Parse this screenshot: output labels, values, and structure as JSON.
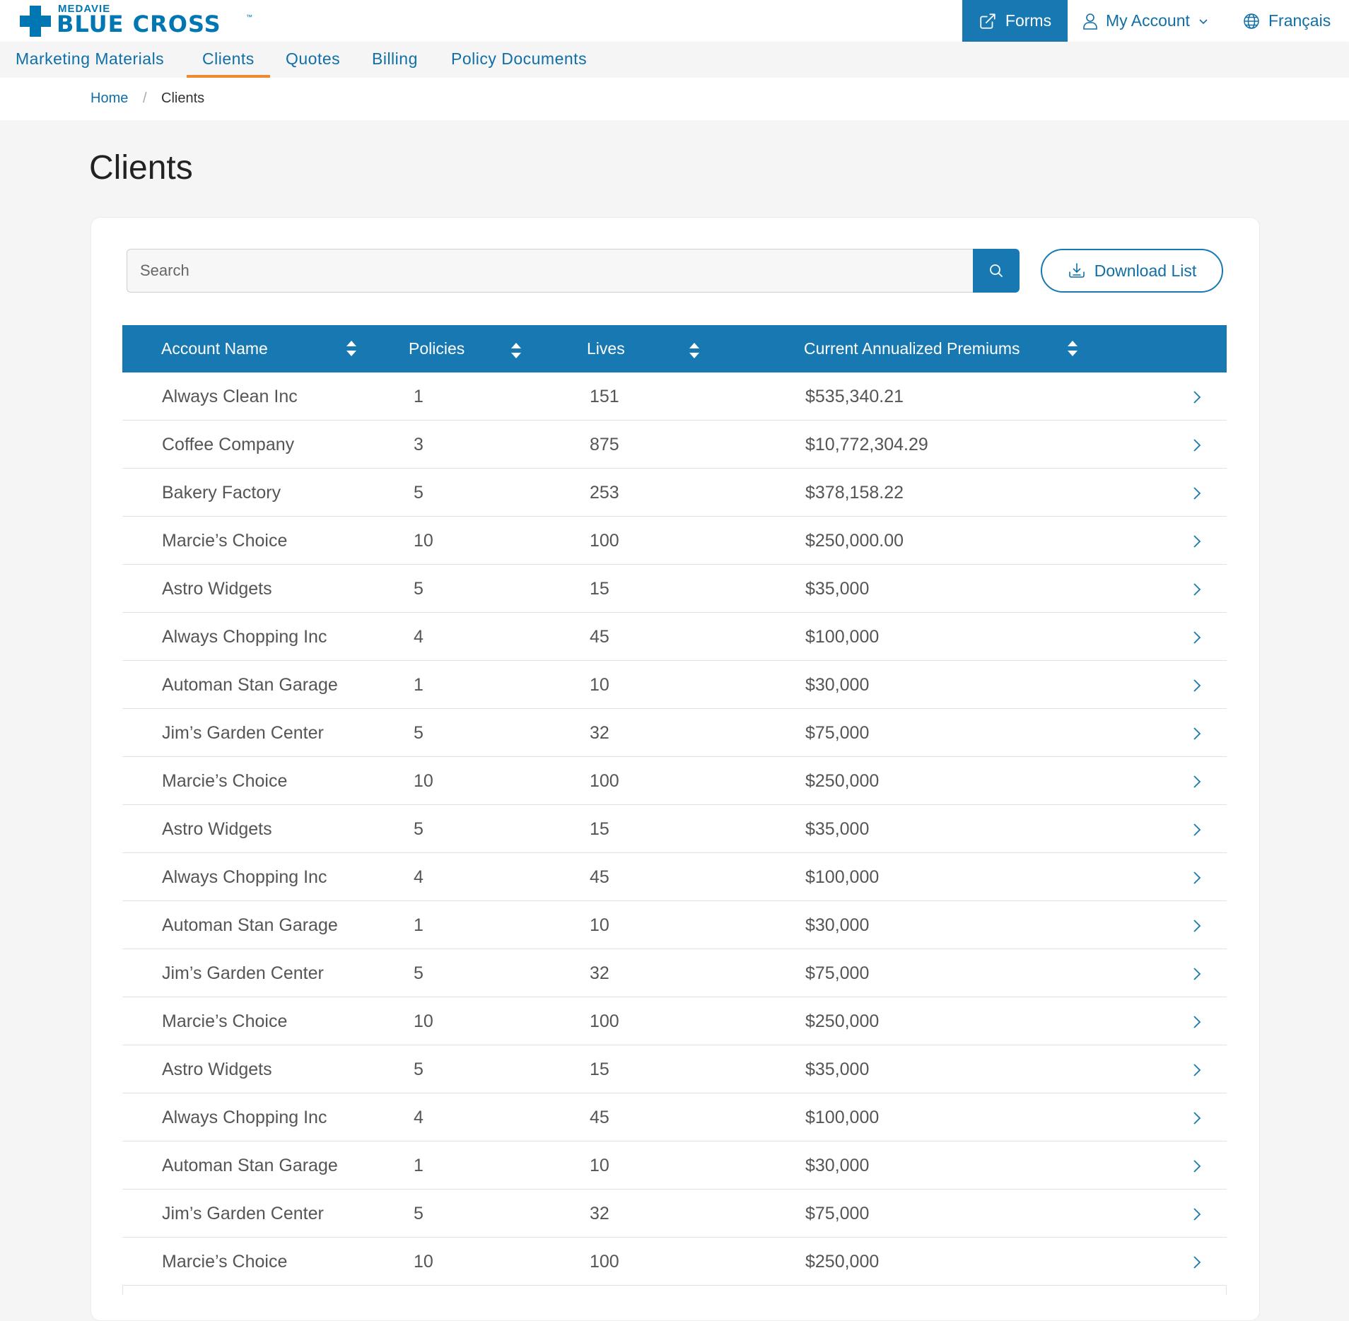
{
  "brand": {
    "top_text": "MEDAVIE",
    "main_text": "BLUE CROSS",
    "trademark": "™",
    "color": "#0077b3"
  },
  "header": {
    "forms_label": "Forms",
    "account_label": "My Account",
    "language_label": "Français",
    "accent_color": "#1878b2"
  },
  "nav": {
    "items": [
      {
        "label": "Marketing Materials",
        "active": false
      },
      {
        "label": "Clients",
        "active": true
      },
      {
        "label": "Quotes",
        "active": false
      },
      {
        "label": "Billing",
        "active": false
      },
      {
        "label": "Policy Documents",
        "active": false
      }
    ],
    "active_underline_color": "#ee8a2d"
  },
  "breadcrumb": {
    "home": "Home",
    "separator": "/",
    "current": "Clients"
  },
  "page": {
    "title": "Clients"
  },
  "search": {
    "placeholder": "Search",
    "value": ""
  },
  "download": {
    "label": "Download List"
  },
  "table": {
    "columns": [
      {
        "label": "Account Name"
      },
      {
        "label": "Policies"
      },
      {
        "label": "Lives"
      },
      {
        "label": "Current Annualized Premiums"
      }
    ],
    "rows": [
      {
        "name": "Always Clean Inc",
        "policies": "1",
        "lives": "151",
        "premium": "$535,340.21"
      },
      {
        "name": "Coffee Company",
        "policies": "3",
        "lives": "875",
        "premium": "$10,772,304.29"
      },
      {
        "name": "Bakery Factory",
        "policies": "5",
        "lives": "253",
        "premium": "$378,158.22"
      },
      {
        "name": "Marcie’s Choice",
        "policies": "10",
        "lives": "100",
        "premium": "$250,000.00"
      },
      {
        "name": "Astro Widgets",
        "policies": "5",
        "lives": "15",
        "premium": "$35,000"
      },
      {
        "name": "Always Chopping Inc",
        "policies": "4",
        "lives": "45",
        "premium": "$100,000"
      },
      {
        "name": "Automan Stan Garage",
        "policies": "1",
        "lives": "10",
        "premium": "$30,000"
      },
      {
        "name": "Jim’s Garden Center",
        "policies": "5",
        "lives": "32",
        "premium": "$75,000"
      },
      {
        "name": "Marcie’s Choice",
        "policies": "10",
        "lives": "100",
        "premium": "$250,000"
      },
      {
        "name": "Astro Widgets",
        "policies": "5",
        "lives": "15",
        "premium": "$35,000"
      },
      {
        "name": "Always Chopping Inc",
        "policies": "4",
        "lives": "45",
        "premium": "$100,000"
      },
      {
        "name": "Automan Stan Garage",
        "policies": "1",
        "lives": "10",
        "premium": "$30,000"
      },
      {
        "name": "Jim’s Garden Center",
        "policies": "5",
        "lives": "32",
        "premium": "$75,000"
      },
      {
        "name": "Marcie’s Choice",
        "policies": "10",
        "lives": "100",
        "premium": "$250,000"
      },
      {
        "name": "Astro Widgets",
        "policies": "5",
        "lives": "15",
        "premium": "$35,000"
      },
      {
        "name": "Always Chopping Inc",
        "policies": "4",
        "lives": "45",
        "premium": "$100,000"
      },
      {
        "name": "Automan Stan Garage",
        "policies": "1",
        "lives": "10",
        "premium": "$30,000"
      },
      {
        "name": "Jim’s Garden Center",
        "policies": "5",
        "lives": "32",
        "premium": "$75,000"
      },
      {
        "name": "Marcie’s Choice",
        "policies": "10",
        "lives": "100",
        "premium": "$250,000"
      }
    ]
  }
}
